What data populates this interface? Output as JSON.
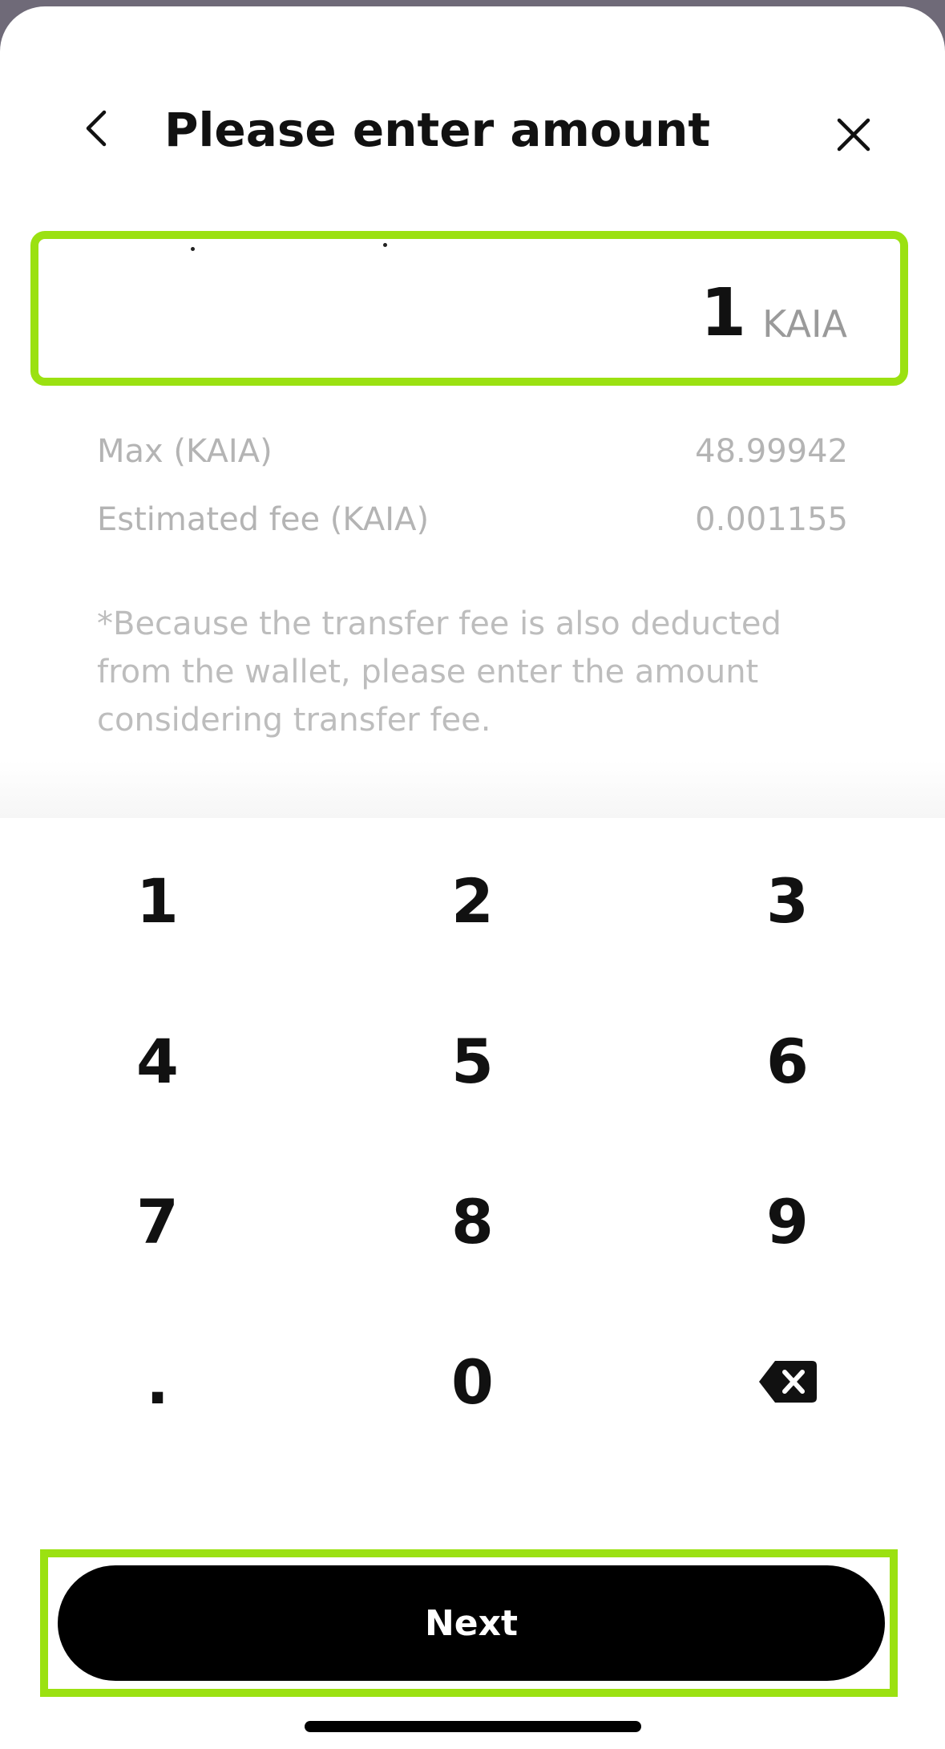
{
  "header": {
    "title": "Please enter amount",
    "back_icon": "chevron-left-icon",
    "close_icon": "close-icon"
  },
  "amount": {
    "value": "1",
    "unit": "KAIA",
    "border_color": "#9be111"
  },
  "info": {
    "max_label": "Max (KAIA)",
    "max_value": "48.99942",
    "fee_label": "Estimated fee (KAIA)",
    "fee_value": "0.001155"
  },
  "note": "*Because the transfer fee is also deducted from the wallet, please enter the amount considering transfer fee.",
  "keypad": {
    "keys": [
      "1",
      "2",
      "3",
      "4",
      "5",
      "6",
      "7",
      "8",
      "9",
      ".",
      "0"
    ],
    "backspace_icon": "backspace-icon"
  },
  "footer": {
    "next_label": "Next"
  }
}
